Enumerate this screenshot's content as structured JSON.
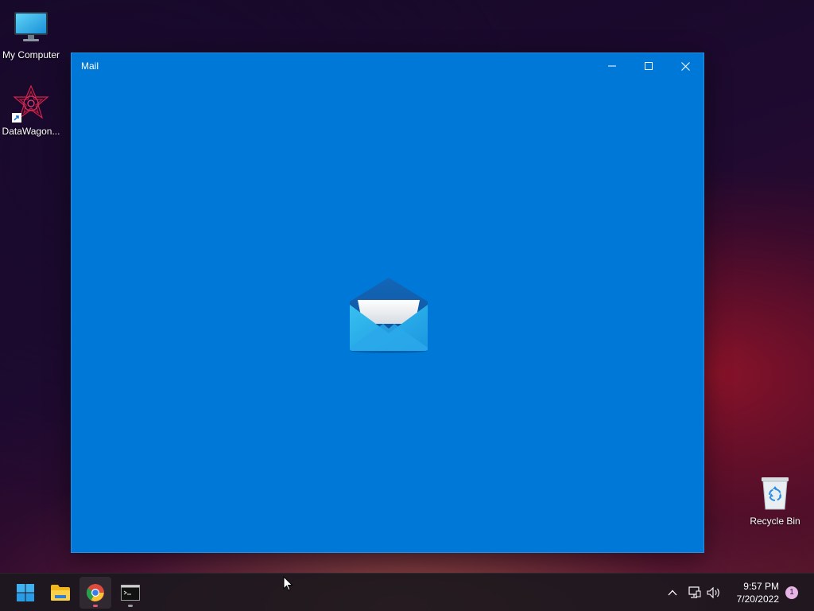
{
  "desktop": {
    "icons": [
      {
        "label": "My Computer",
        "icon": "monitor-icon"
      },
      {
        "label": "DataWagon...",
        "icon": "datawagon-app-icon",
        "shortcut": true
      },
      {
        "label": "Recycle Bin",
        "icon": "recycle-bin-icon"
      }
    ]
  },
  "window": {
    "title": "Mail",
    "background_color": "#0078d7",
    "controls": [
      "minimize-icon",
      "maximize-icon",
      "close-icon"
    ],
    "splash_icon": "mail-envelope-icon"
  },
  "taskbar": {
    "pinned": [
      {
        "name": "Start",
        "icon": "windows-start-icon"
      },
      {
        "name": "File Explorer",
        "icon": "folder-icon"
      },
      {
        "name": "Google Chrome",
        "icon": "chrome-icon",
        "active": true
      },
      {
        "name": "Command Prompt",
        "icon": "terminal-icon",
        "running": true
      }
    ],
    "tray": {
      "icons": [
        "chevron-up-icon",
        "network-icon",
        "volume-icon"
      ],
      "time": "9:57 PM",
      "date": "7/20/2022",
      "notification_count": "1"
    }
  }
}
